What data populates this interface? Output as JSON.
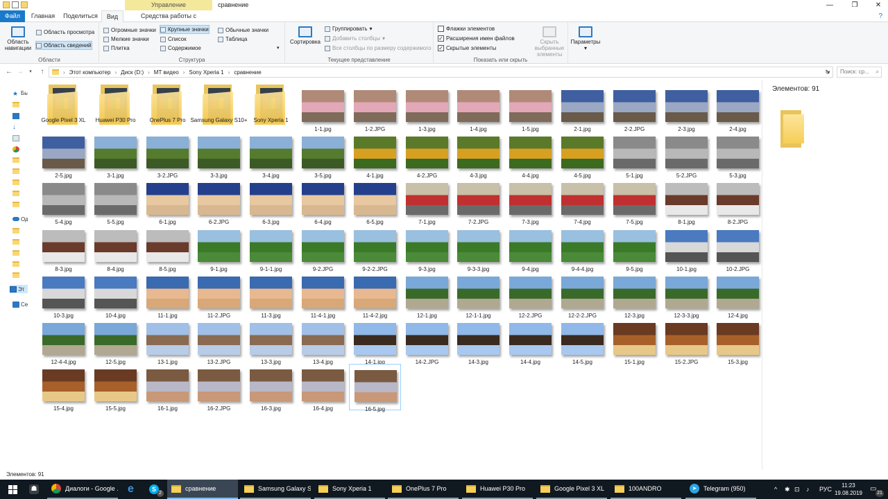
{
  "window": {
    "title": "сравнение",
    "context_tab": "Управление",
    "qa_icons": [
      "folder-icon",
      "properties-icon",
      "new-folder-icon"
    ],
    "controls": [
      "—",
      "❐",
      "✕"
    ]
  },
  "ribbon_tabs": {
    "file": "Файл",
    "home": "Главная",
    "share": "Поделиться",
    "view": "Вид",
    "picture_tools": "Средства работы с рисунками"
  },
  "ribbon": {
    "panes": {
      "label": "Области",
      "navigation_pane": "Область навигации",
      "preview_pane": "Область просмотра",
      "details_pane": "Область сведений"
    },
    "layout": {
      "label": "Структура",
      "extra_large": "Огромные значки",
      "large": "Крупные значки",
      "medium": "Обычные значки",
      "small": "Мелкие значки",
      "list": "Список",
      "details": "Таблица",
      "tiles": "Плитка",
      "content": "Содержимое"
    },
    "current_view": {
      "label": "Текущее представление",
      "sort": "Сортировка",
      "group_by": "Группировать",
      "add_columns": "Добавить столбцы",
      "size_all_columns": "Все столбцы по размеру содержимого"
    },
    "show_hide": {
      "label": "Показать или скрыть",
      "item_checkboxes": "Флажки элементов",
      "item_checkboxes_checked": false,
      "file_extensions": "Расширения имен файлов",
      "file_extensions_checked": true,
      "hidden_items": "Скрытые элементы",
      "hidden_items_checked": true,
      "hide_selected": "Скрыть выбранные элементы"
    },
    "options": "Параметры"
  },
  "address": {
    "crumbs": [
      "Этот компьютер",
      "Диск (D:)",
      "MT видео",
      "Sony Xperia 1",
      "сравнение"
    ],
    "search_placeholder": "Поиск: ср..."
  },
  "nav_pane": {
    "items": [
      "Бы",
      "",
      "",
      "",
      "",
      "",
      "",
      "",
      "",
      "",
      "",
      "Од",
      "",
      "",
      "",
      "",
      "",
      "Эт",
      "",
      "Се"
    ]
  },
  "folders": [
    "Google Pixel 3 XL",
    "Huawei P30 Pro",
    "OnePlus 7 Pro",
    "Samsung Galaxy S10+",
    "Sony Xperia 1"
  ],
  "files": [
    "1-1.jpg",
    "1-2.JPG",
    "1-3.jpg",
    "1-4.jpg",
    "1-5.jpg",
    "2-1.jpg",
    "2-2.JPG",
    "2-3.jpg",
    "2-4.jpg",
    "2-5.jpg",
    "3-1.jpg",
    "3-2.JPG",
    "3-3.jpg",
    "3-4.jpg",
    "3-5.jpg",
    "4-1.jpg",
    "4-2.JPG",
    "4-3.jpg",
    "4-4.jpg",
    "4-5.jpg",
    "5-1.jpg",
    "5-2.JPG",
    "5-3.jpg",
    "5-4.jpg",
    "5-5.jpg",
    "6-1.jpg",
    "6-2.JPG",
    "6-3.jpg",
    "6-4.jpg",
    "6-5.jpg",
    "7-1.jpg",
    "7-2.JPG",
    "7-3.jpg",
    "7-4.jpg",
    "7-5.jpg",
    "8-1.jpg",
    "8-2.JPG",
    "8-3.jpg",
    "8-4.jpg",
    "8-5.jpg",
    "9-1.jpg",
    "9-1-1.jpg",
    "9-2.JPG",
    "9-2-2.JPG",
    "9-3.jpg",
    "9-3-3.jpg",
    "9-4.jpg",
    "9-4-4.jpg",
    "9-5.jpg",
    "10-1.jpg",
    "10-2.JPG",
    "10-3.jpg",
    "10-4.jpg",
    "11-1.jpg",
    "11-2.JPG",
    "11-3.jpg",
    "11-4-1.jpg",
    "11-4-2.jpg",
    "12-1.jpg",
    "12-1-1.jpg",
    "12-2.JPG",
    "12-2-2.JPG",
    "12-3.jpg",
    "12-3-3.jpg",
    "12-4.jpg",
    "12-4-4.jpg",
    "12-5.jpg",
    "13-1.jpg",
    "13-2.JPG",
    "13-3.jpg",
    "13-4.jpg",
    "14-1.jpg",
    "14-2.JPG",
    "14-3.jpg",
    "14-4.jpg",
    "14-5.jpg",
    "15-1.jpg",
    "15-2.JPG",
    "15-3.jpg",
    "15-4.jpg",
    "15-5.jpg",
    "16-1.jpg",
    "16-2.JPG",
    "16-3.jpg",
    "16-4.jpg",
    "16-5.jpg"
  ],
  "selected_file": "16-5.jpg",
  "details_pane": {
    "count": "Элементов: 91"
  },
  "status": {
    "count": "Элементов: 91"
  },
  "taskbar": {
    "items": [
      {
        "label": "Диалоги - Google ...",
        "icon": "chrome-icon"
      },
      {
        "label": "сравнение",
        "icon": "folder-icon"
      },
      {
        "label": "Samsung Galaxy S1...",
        "icon": "folder-icon"
      },
      {
        "label": "Sony Xperia 1",
        "icon": "folder-icon"
      },
      {
        "label": "OnePlus 7 Pro",
        "icon": "folder-icon"
      },
      {
        "label": "Huawei P30 Pro",
        "icon": "folder-icon"
      },
      {
        "label": "Google Pixel 3 XL",
        "icon": "folder-icon"
      },
      {
        "label": "100ANDRO",
        "icon": "folder-icon"
      },
      {
        "label": "Telegram (950)",
        "icon": "telegram-icon"
      }
    ],
    "skype_badge": "2",
    "language": "РУС",
    "time": "11:23",
    "date": "19.08.2019",
    "notifications": "21"
  },
  "colors": {
    "accent": "#1979ca",
    "selection": "#cce8ff",
    "taskbar": "#101820"
  }
}
